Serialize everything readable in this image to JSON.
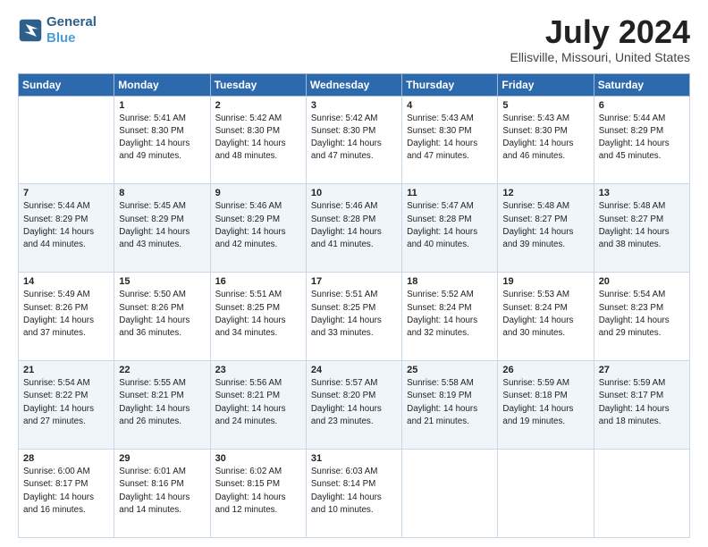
{
  "logo": {
    "line1": "General",
    "line2": "Blue"
  },
  "title": "July 2024",
  "subtitle": "Ellisville, Missouri, United States",
  "header_days": [
    "Sunday",
    "Monday",
    "Tuesday",
    "Wednesday",
    "Thursday",
    "Friday",
    "Saturday"
  ],
  "weeks": [
    [
      {
        "day": "",
        "sunrise": "",
        "sunset": "",
        "daylight": ""
      },
      {
        "day": "1",
        "sunrise": "Sunrise: 5:41 AM",
        "sunset": "Sunset: 8:30 PM",
        "daylight": "Daylight: 14 hours and 49 minutes."
      },
      {
        "day": "2",
        "sunrise": "Sunrise: 5:42 AM",
        "sunset": "Sunset: 8:30 PM",
        "daylight": "Daylight: 14 hours and 48 minutes."
      },
      {
        "day": "3",
        "sunrise": "Sunrise: 5:42 AM",
        "sunset": "Sunset: 8:30 PM",
        "daylight": "Daylight: 14 hours and 47 minutes."
      },
      {
        "day": "4",
        "sunrise": "Sunrise: 5:43 AM",
        "sunset": "Sunset: 8:30 PM",
        "daylight": "Daylight: 14 hours and 47 minutes."
      },
      {
        "day": "5",
        "sunrise": "Sunrise: 5:43 AM",
        "sunset": "Sunset: 8:30 PM",
        "daylight": "Daylight: 14 hours and 46 minutes."
      },
      {
        "day": "6",
        "sunrise": "Sunrise: 5:44 AM",
        "sunset": "Sunset: 8:29 PM",
        "daylight": "Daylight: 14 hours and 45 minutes."
      }
    ],
    [
      {
        "day": "7",
        "sunrise": "Sunrise: 5:44 AM",
        "sunset": "Sunset: 8:29 PM",
        "daylight": "Daylight: 14 hours and 44 minutes."
      },
      {
        "day": "8",
        "sunrise": "Sunrise: 5:45 AM",
        "sunset": "Sunset: 8:29 PM",
        "daylight": "Daylight: 14 hours and 43 minutes."
      },
      {
        "day": "9",
        "sunrise": "Sunrise: 5:46 AM",
        "sunset": "Sunset: 8:29 PM",
        "daylight": "Daylight: 14 hours and 42 minutes."
      },
      {
        "day": "10",
        "sunrise": "Sunrise: 5:46 AM",
        "sunset": "Sunset: 8:28 PM",
        "daylight": "Daylight: 14 hours and 41 minutes."
      },
      {
        "day": "11",
        "sunrise": "Sunrise: 5:47 AM",
        "sunset": "Sunset: 8:28 PM",
        "daylight": "Daylight: 14 hours and 40 minutes."
      },
      {
        "day": "12",
        "sunrise": "Sunrise: 5:48 AM",
        "sunset": "Sunset: 8:27 PM",
        "daylight": "Daylight: 14 hours and 39 minutes."
      },
      {
        "day": "13",
        "sunrise": "Sunrise: 5:48 AM",
        "sunset": "Sunset: 8:27 PM",
        "daylight": "Daylight: 14 hours and 38 minutes."
      }
    ],
    [
      {
        "day": "14",
        "sunrise": "Sunrise: 5:49 AM",
        "sunset": "Sunset: 8:26 PM",
        "daylight": "Daylight: 14 hours and 37 minutes."
      },
      {
        "day": "15",
        "sunrise": "Sunrise: 5:50 AM",
        "sunset": "Sunset: 8:26 PM",
        "daylight": "Daylight: 14 hours and 36 minutes."
      },
      {
        "day": "16",
        "sunrise": "Sunrise: 5:51 AM",
        "sunset": "Sunset: 8:25 PM",
        "daylight": "Daylight: 14 hours and 34 minutes."
      },
      {
        "day": "17",
        "sunrise": "Sunrise: 5:51 AM",
        "sunset": "Sunset: 8:25 PM",
        "daylight": "Daylight: 14 hours and 33 minutes."
      },
      {
        "day": "18",
        "sunrise": "Sunrise: 5:52 AM",
        "sunset": "Sunset: 8:24 PM",
        "daylight": "Daylight: 14 hours and 32 minutes."
      },
      {
        "day": "19",
        "sunrise": "Sunrise: 5:53 AM",
        "sunset": "Sunset: 8:24 PM",
        "daylight": "Daylight: 14 hours and 30 minutes."
      },
      {
        "day": "20",
        "sunrise": "Sunrise: 5:54 AM",
        "sunset": "Sunset: 8:23 PM",
        "daylight": "Daylight: 14 hours and 29 minutes."
      }
    ],
    [
      {
        "day": "21",
        "sunrise": "Sunrise: 5:54 AM",
        "sunset": "Sunset: 8:22 PM",
        "daylight": "Daylight: 14 hours and 27 minutes."
      },
      {
        "day": "22",
        "sunrise": "Sunrise: 5:55 AM",
        "sunset": "Sunset: 8:21 PM",
        "daylight": "Daylight: 14 hours and 26 minutes."
      },
      {
        "day": "23",
        "sunrise": "Sunrise: 5:56 AM",
        "sunset": "Sunset: 8:21 PM",
        "daylight": "Daylight: 14 hours and 24 minutes."
      },
      {
        "day": "24",
        "sunrise": "Sunrise: 5:57 AM",
        "sunset": "Sunset: 8:20 PM",
        "daylight": "Daylight: 14 hours and 23 minutes."
      },
      {
        "day": "25",
        "sunrise": "Sunrise: 5:58 AM",
        "sunset": "Sunset: 8:19 PM",
        "daylight": "Daylight: 14 hours and 21 minutes."
      },
      {
        "day": "26",
        "sunrise": "Sunrise: 5:59 AM",
        "sunset": "Sunset: 8:18 PM",
        "daylight": "Daylight: 14 hours and 19 minutes."
      },
      {
        "day": "27",
        "sunrise": "Sunrise: 5:59 AM",
        "sunset": "Sunset: 8:17 PM",
        "daylight": "Daylight: 14 hours and 18 minutes."
      }
    ],
    [
      {
        "day": "28",
        "sunrise": "Sunrise: 6:00 AM",
        "sunset": "Sunset: 8:17 PM",
        "daylight": "Daylight: 14 hours and 16 minutes."
      },
      {
        "day": "29",
        "sunrise": "Sunrise: 6:01 AM",
        "sunset": "Sunset: 8:16 PM",
        "daylight": "Daylight: 14 hours and 14 minutes."
      },
      {
        "day": "30",
        "sunrise": "Sunrise: 6:02 AM",
        "sunset": "Sunset: 8:15 PM",
        "daylight": "Daylight: 14 hours and 12 minutes."
      },
      {
        "day": "31",
        "sunrise": "Sunrise: 6:03 AM",
        "sunset": "Sunset: 8:14 PM",
        "daylight": "Daylight: 14 hours and 10 minutes."
      },
      {
        "day": "",
        "sunrise": "",
        "sunset": "",
        "daylight": ""
      },
      {
        "day": "",
        "sunrise": "",
        "sunset": "",
        "daylight": ""
      },
      {
        "day": "",
        "sunrise": "",
        "sunset": "",
        "daylight": ""
      }
    ]
  ]
}
